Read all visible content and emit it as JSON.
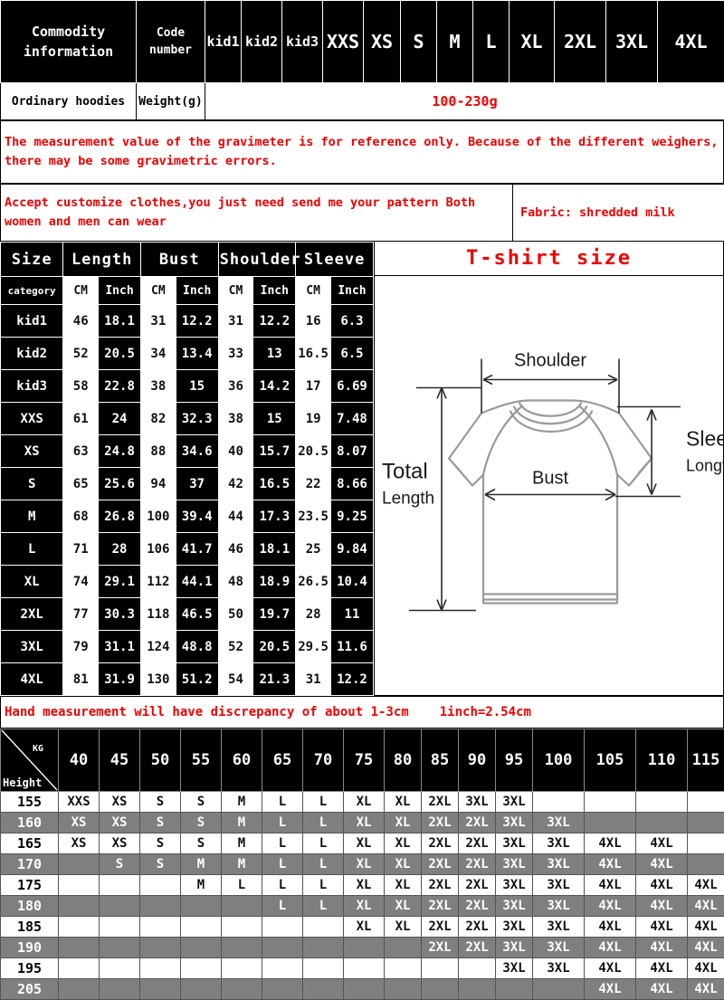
{
  "commodity": {
    "header_label": "Commodity information",
    "code_label": "Code number",
    "size_columns": [
      "kid1",
      "kid2",
      "kid3",
      "XXS",
      "XS",
      "S",
      "M",
      "L",
      "XL",
      "2XL",
      "3XL",
      "4XL"
    ],
    "product_name": "Ordinary hoodies",
    "weight_label": "Weight(g)",
    "weight_value": "100-230g"
  },
  "notes": {
    "gravimeter": "The measurement value of the gravimeter is for reference only. Because of the different weighers, there may be some gravimetric errors.",
    "customize": "Accept customize clothes,you just need send me your pattern Both women and men can wear",
    "fabric": "Fabric: shredded milk",
    "hand_measure": "Hand measurement will have discrepancy of about 1-3cm",
    "inch_conversion": "1inch=2.54cm"
  },
  "size_table": {
    "col_size": "Size",
    "col_category": "category",
    "groups": [
      "Length",
      "Bust",
      "Shoulder",
      "Sleeve"
    ],
    "units": [
      "CM",
      "Inch",
      "CM",
      "Inch",
      "CM",
      "Inch",
      "CM",
      "Inch"
    ],
    "rows": [
      {
        "size": "kid1",
        "values": [
          "46",
          "18.1",
          "31",
          "12.2",
          "31",
          "12.2",
          "16",
          "6.3"
        ]
      },
      {
        "size": "kid2",
        "values": [
          "52",
          "20.5",
          "34",
          "13.4",
          "33",
          "13",
          "16.5",
          "6.5"
        ]
      },
      {
        "size": "kid3",
        "values": [
          "58",
          "22.8",
          "38",
          "15",
          "36",
          "14.2",
          "17",
          "6.69"
        ]
      },
      {
        "size": "XXS",
        "values": [
          "61",
          "24",
          "82",
          "32.3",
          "38",
          "15",
          "19",
          "7.48"
        ]
      },
      {
        "size": "XS",
        "values": [
          "63",
          "24.8",
          "88",
          "34.6",
          "40",
          "15.7",
          "20.5",
          "8.07"
        ]
      },
      {
        "size": "S",
        "values": [
          "65",
          "25.6",
          "94",
          "37",
          "42",
          "16.5",
          "22",
          "8.66"
        ]
      },
      {
        "size": "M",
        "values": [
          "68",
          "26.8",
          "100",
          "39.4",
          "44",
          "17.3",
          "23.5",
          "9.25"
        ]
      },
      {
        "size": "L",
        "values": [
          "71",
          "28",
          "106",
          "41.7",
          "46",
          "18.1",
          "25",
          "9.84"
        ]
      },
      {
        "size": "XL",
        "values": [
          "74",
          "29.1",
          "112",
          "44.1",
          "48",
          "18.9",
          "26.5",
          "10.4"
        ]
      },
      {
        "size": "2XL",
        "values": [
          "77",
          "30.3",
          "118",
          "46.5",
          "50",
          "19.7",
          "28",
          "11"
        ]
      },
      {
        "size": "3XL",
        "values": [
          "79",
          "31.1",
          "124",
          "48.8",
          "52",
          "20.5",
          "29.5",
          "11.6"
        ]
      },
      {
        "size": "4XL",
        "values": [
          "81",
          "31.9",
          "130",
          "51.2",
          "54",
          "21.3",
          "31",
          "12.2"
        ]
      }
    ]
  },
  "shirt_diagram": {
    "title": "T-shirt size",
    "labels": {
      "shoulder": "Shoulder",
      "bust": "Bust",
      "sleeve": "Sleeve",
      "sleeve_sub": "Longth",
      "total": "Total",
      "total_sub": "Length"
    }
  },
  "fit_grid": {
    "kg_label": "KG",
    "height_label": "Height",
    "kg_columns": [
      "40",
      "45",
      "50",
      "55",
      "60",
      "65",
      "70",
      "75",
      "80",
      "85",
      "90",
      "95",
      "100",
      "105",
      "110",
      "115"
    ],
    "rows": [
      {
        "height": "155",
        "cells": [
          "XXS",
          "XS",
          "S",
          "S",
          "M",
          "L",
          "L",
          "XL",
          "XL",
          "2XL",
          "3XL",
          "3XL",
          "",
          "",
          "",
          ""
        ]
      },
      {
        "height": "160",
        "cells": [
          "XS",
          "XS",
          "S",
          "S",
          "M",
          "L",
          "L",
          "XL",
          "XL",
          "2XL",
          "2XL",
          "3XL",
          "3XL",
          "",
          "",
          ""
        ]
      },
      {
        "height": "165",
        "cells": [
          "XS",
          "XS",
          "S",
          "S",
          "M",
          "L",
          "L",
          "XL",
          "XL",
          "2XL",
          "2XL",
          "3XL",
          "3XL",
          "4XL",
          "4XL",
          ""
        ]
      },
      {
        "height": "170",
        "cells": [
          "",
          "S",
          "S",
          "M",
          "M",
          "L",
          "L",
          "XL",
          "XL",
          "2XL",
          "2XL",
          "3XL",
          "3XL",
          "4XL",
          "4XL",
          ""
        ]
      },
      {
        "height": "175",
        "cells": [
          "",
          "",
          "",
          "M",
          "L",
          "L",
          "L",
          "XL",
          "XL",
          "2XL",
          "2XL",
          "3XL",
          "3XL",
          "4XL",
          "4XL",
          "4XL"
        ]
      },
      {
        "height": "180",
        "cells": [
          "",
          "",
          "",
          "",
          "",
          "L",
          "L",
          "XL",
          "XL",
          "2XL",
          "2XL",
          "3XL",
          "3XL",
          "4XL",
          "4XL",
          "4XL"
        ]
      },
      {
        "height": "185",
        "cells": [
          "",
          "",
          "",
          "",
          "",
          "",
          "",
          "XL",
          "XL",
          "2XL",
          "2XL",
          "3XL",
          "3XL",
          "4XL",
          "4XL",
          "4XL"
        ]
      },
      {
        "height": "190",
        "cells": [
          "",
          "",
          "",
          "",
          "",
          "",
          "",
          "",
          "",
          "2XL",
          "2XL",
          "3XL",
          "3XL",
          "4XL",
          "4XL",
          "4XL"
        ]
      },
      {
        "height": "195",
        "cells": [
          "",
          "",
          "",
          "",
          "",
          "",
          "",
          "",
          "",
          "",
          "",
          "3XL",
          "3XL",
          "4XL",
          "4XL",
          "4XL"
        ]
      },
      {
        "height": "205",
        "cells": [
          "",
          "",
          "",
          "",
          "",
          "",
          "",
          "",
          "",
          "",
          "",
          "",
          "",
          "4XL",
          "4XL",
          "4XL"
        ]
      }
    ]
  },
  "colors": {
    "accent_red": "#ee0000",
    "dark": "#000000",
    "band_gray": "#7f7f7f"
  }
}
